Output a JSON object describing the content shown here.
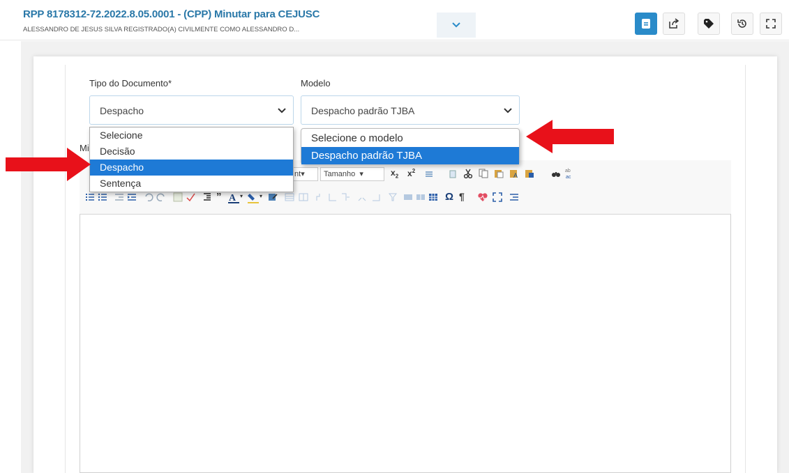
{
  "header": {
    "title": "RPP 8178312-72.2022.8.05.0001 - (CPP) Minutar para CEJUSC",
    "subtitle": "ALESSANDRO DE JESUS SILVA REGISTRADO(A) CIVILMENTE COMO ALESSANDRO D..."
  },
  "form": {
    "tipo_label": "Tipo do Documento*",
    "tipo_value": "Despacho",
    "tipo_options": [
      "Selecione",
      "Decisão",
      "Despacho",
      "Sentença"
    ],
    "tipo_selected_index": 2,
    "modelo_label": "Modelo",
    "modelo_value": "Despacho padrão TJBA",
    "modelo_options": [
      "Selecione o modelo",
      "Despacho padrão TJBA"
    ],
    "modelo_selected_index": 1,
    "minuta_label": "Mi"
  },
  "toolbar": {
    "font_label": "nt",
    "size_label": "Tamanho",
    "subscript": "x",
    "superscript": "x"
  },
  "colors": {
    "accent": "#2a78a8",
    "selected": "#1e7ad6",
    "arrow": "#e8111a"
  },
  "icons": [
    "document-icon",
    "share-icon",
    "tag-icon",
    "history-icon",
    "fullscreen-icon",
    "chevron-down-icon"
  ]
}
